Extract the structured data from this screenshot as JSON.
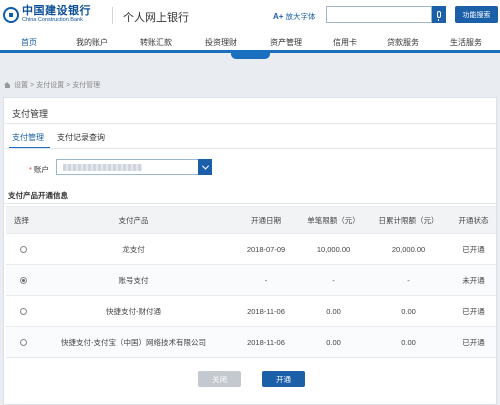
{
  "header": {
    "logo_cn": "中国建设银行",
    "logo_en": "China Construction Bank",
    "portal_title": "个人网上银行",
    "font_size_icon": "A+",
    "font_size_label": "放大字体",
    "search_placeholder": "",
    "function_search_label": "功能搜索"
  },
  "nav": {
    "items": [
      "首页",
      "我的账户",
      "转账汇款",
      "投资理财",
      "资产管理",
      "信用卡",
      "贷款服务",
      "生活服务"
    ],
    "active_index": 0
  },
  "breadcrumb": [
    "设置",
    "支付设置",
    "支付管理"
  ],
  "panel": {
    "title": "支付管理",
    "tabs": [
      "支付管理",
      "支付记录查询"
    ],
    "active_tab": 0,
    "account_label": "账户",
    "required_mark": "*",
    "section_title": "支付产品开通信息"
  },
  "table": {
    "headers": [
      "选择",
      "支付产品",
      "开通日期",
      "单笔限额（元）",
      "日累计限额（元）",
      "开通状态"
    ],
    "rows": [
      {
        "selected": false,
        "product": "龙支付",
        "date": "2018-07-09",
        "single_limit": "10,000.00",
        "daily_limit": "20,000.00",
        "status": "已开通"
      },
      {
        "selected": true,
        "product": "账号支付",
        "date": "-",
        "single_limit": "-",
        "daily_limit": "-",
        "status": "未开通"
      },
      {
        "selected": false,
        "product": "快捷支付-财付通",
        "date": "2018-11-06",
        "single_limit": "0.00",
        "daily_limit": "0.00",
        "status": "已开通"
      },
      {
        "selected": false,
        "product": "快捷支付-支付宝（中国）网络技术有限公司",
        "date": "2018-11-06",
        "single_limit": "0.00",
        "daily_limit": "0.00",
        "status": "已开通"
      }
    ]
  },
  "buttons": {
    "close_label": "关闭",
    "open_label": "开通"
  },
  "colors": {
    "brand_blue": "#1a5fa8",
    "nav_accent": "#1a6fbf",
    "disabled_gray": "#c4c9cf"
  }
}
